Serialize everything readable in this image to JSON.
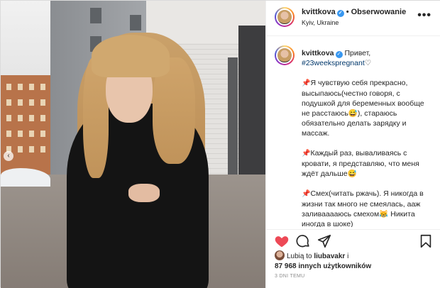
{
  "header": {
    "username": "kvittkova",
    "separator": "•",
    "follow_label": "Obserwowanie",
    "location": "Kyiv, Ukraine",
    "more": "•••"
  },
  "caption": {
    "username": "kvittkova",
    "greeting": "Привет,",
    "hashtag": "#23weekspregnant",
    "heart": "♡",
    "pin": "📌",
    "paragraph_1": "Я чувствую себя прекрасно, высыпаюсь(честно говоря, с подушкой для беременных вообще не расстаюсь😅), стараюсь обязательно делать зарядку и массаж.",
    "paragraph_2": "Каждый раз, вываливаясь с кровати, я представляю, что меня ждёт дальше😅",
    "paragraph_3": "Смех(читать ржачь). Я никогда в жизни так много не смеялась, ааж заливааааюсь смехом😹 Никита иногда в шоке)"
  },
  "actions": {
    "like_icon": "heart-icon",
    "comment_icon": "comment-icon",
    "share_icon": "share-icon",
    "save_icon": "bookmark-icon"
  },
  "likes": {
    "prefix": "Lubią to",
    "first_user": "liubavakr",
    "conjunction": "i",
    "count_text": "87 968 innych użytkowników"
  },
  "timestamp": "3 DNI TEMU",
  "colors": {
    "verified": "#3897f0",
    "liked_heart": "#ed4956",
    "hashtag": "#00376b"
  }
}
